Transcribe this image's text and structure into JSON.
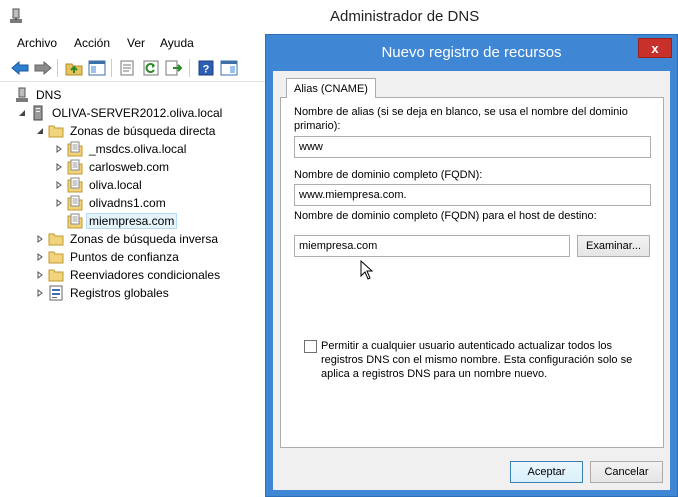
{
  "window": {
    "title": "Administrador de DNS"
  },
  "menu": [
    "Archivo",
    "Acción",
    "Ver",
    "Ayuda"
  ],
  "toolbar": {
    "buttons": [
      "back-arrow-icon",
      "forward-arrow-icon",
      "folder-up-icon",
      "console-tree-icon",
      "properties-icon",
      "refresh-icon",
      "export-list-icon",
      "help-icon",
      "show-pane-icon"
    ]
  },
  "tree": {
    "root": "DNS",
    "server": "OLIVA-SERVER2012.oliva.local",
    "forward_zones": "Zonas de búsqueda directa",
    "zones": [
      "_msdcs.oliva.local",
      "carlosweb.com",
      "oliva.local",
      "olivadns1.com",
      "miempresa.com"
    ],
    "reverse_zones": "Zonas de búsqueda inversa",
    "trust_points": "Puntos de confianza",
    "conditional_forwarders": "Reenviadores condicionales",
    "global_logs": "Registros globales"
  },
  "dialog": {
    "title": "Nuevo registro de recursos",
    "close_label": "x",
    "tab_label": "Alias (CNAME)",
    "alias_label": "Nombre de alias (si se deja en blanco, se usa el nombre del dominio primario):",
    "alias_value": "www",
    "fqdn_label": "Nombre de dominio completo (FQDN):",
    "fqdn_value": "www.miempresa.com.",
    "target_label": "Nombre de dominio completo (FQDN) para el host de destino:",
    "target_value": "miempresa.com",
    "browse_label": "Examinar...",
    "checkbox_label": "Permitir a cualquier usuario autenticado actualizar todos los registros DNS con el mismo nombre. Esta configuración solo se aplica a registros DNS para un nombre nuevo.",
    "checkbox_checked": false,
    "ok_label": "Aceptar",
    "cancel_label": "Cancelar"
  }
}
